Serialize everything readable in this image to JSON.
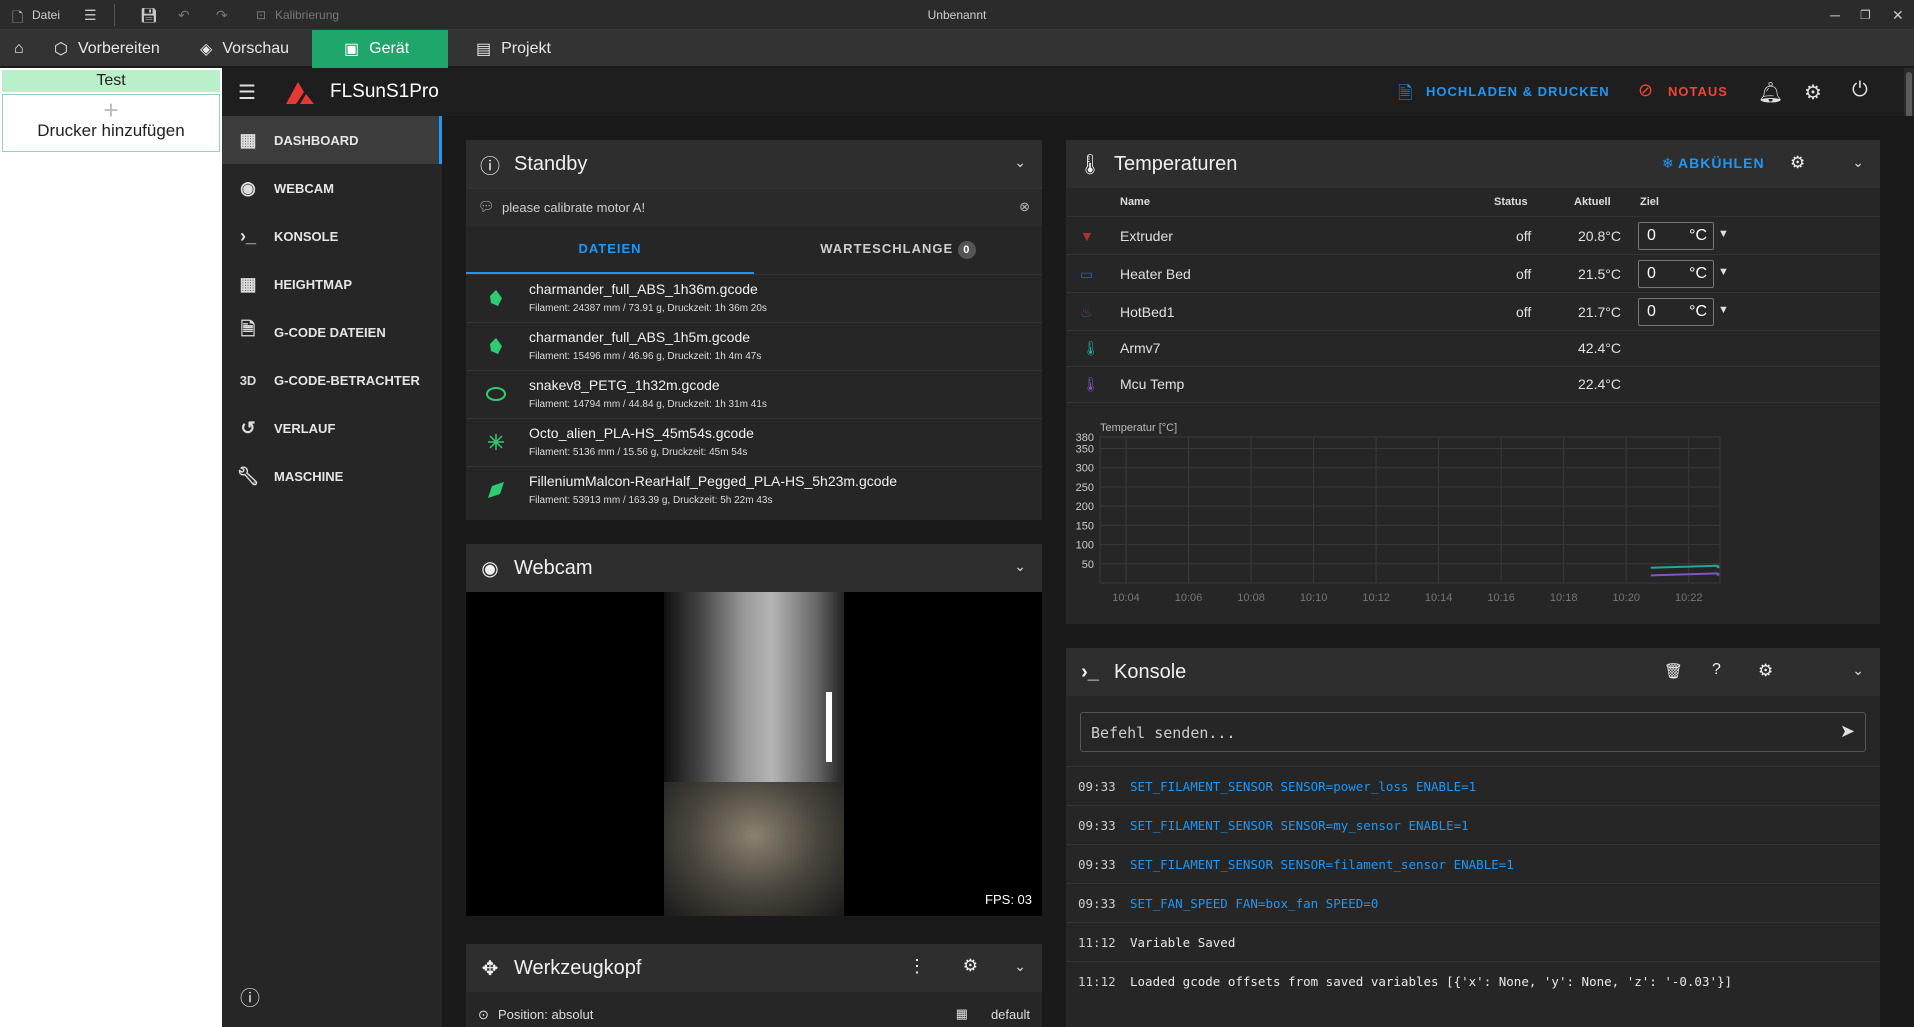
{
  "titlebar": {
    "file_label": "Datei",
    "calib_label": "Kalibrierung",
    "title": "Unbenannt"
  },
  "apptabs": [
    {
      "label": "Vorbereiten"
    },
    {
      "label": "Vorschau"
    },
    {
      "label": "Gerät"
    },
    {
      "label": "Projekt"
    }
  ],
  "printers": {
    "tab_label": "Test",
    "add_label": "Drucker hinzufügen"
  },
  "header": {
    "printer_name": "FLSunS1Pro",
    "upload_label": "HOCHLADEN & DRUCKEN",
    "estop_label": "NOTAUS",
    "colors": {
      "accent": "#2196f3",
      "danger": "#f44336"
    }
  },
  "nav": [
    {
      "label": "DASHBOARD",
      "icon": "dashboard-icon"
    },
    {
      "label": "WEBCAM",
      "icon": "webcam-icon"
    },
    {
      "label": "KONSOLE",
      "icon": "console-icon"
    },
    {
      "label": "HEIGHTMAP",
      "icon": "grid-icon"
    },
    {
      "label": "G-CODE DATEIEN",
      "icon": "file-icon"
    },
    {
      "label": "G-CODE-BETRACHTER",
      "icon": "3d-icon"
    },
    {
      "label": "VERLAUF",
      "icon": "history-icon"
    },
    {
      "label": "MASCHINE",
      "icon": "wrench-icon"
    }
  ],
  "status": {
    "title": "Standby",
    "message": "please calibrate motor A!",
    "tab_files": "DATEIEN",
    "tab_queue": "WARTESCHLANGE",
    "queue_count": "0",
    "files": [
      {
        "name": "charmander_full_ABS_1h36m.gcode",
        "meta": "Filament: 24387 mm / 73.91 g, Druckzeit: 1h 36m 20s"
      },
      {
        "name": "charmander_full_ABS_1h5m.gcode",
        "meta": "Filament: 15496 mm / 46.96 g, Druckzeit: 1h 4m 47s"
      },
      {
        "name": "snakev8_PETG_1h32m.gcode",
        "meta": "Filament: 14794 mm / 44.84 g, Druckzeit: 1h 31m 41s"
      },
      {
        "name": "Octo_alien_PLA-HS_45m54s.gcode",
        "meta": "Filament: 5136 mm / 15.56 g, Druckzeit: 45m 54s"
      },
      {
        "name": "FilleniumMalcon-RearHalf_Pegged_PLA-HS_5h23m.gcode",
        "meta": "Filament: 53913 mm / 163.39 g, Druckzeit: 5h 22m 43s"
      }
    ]
  },
  "webcam": {
    "title": "Webcam",
    "fps": "FPS: 03"
  },
  "toolhead": {
    "title": "Werkzeugkopf",
    "position": "Position: absolut",
    "profile": "default"
  },
  "temps": {
    "title": "Temperaturen",
    "cool_label": "ABKÜHLEN",
    "columns": {
      "name": "Name",
      "status": "Status",
      "actual": "Aktuell",
      "target": "Ziel"
    },
    "unit": "°C",
    "rows": [
      {
        "name": "Extruder",
        "status": "off",
        "actual": "20.8°C",
        "target": "0"
      },
      {
        "name": "Heater Bed",
        "status": "off",
        "actual": "21.5°C",
        "target": "0"
      },
      {
        "name": "HotBed1",
        "status": "off",
        "actual": "21.7°C",
        "target": "0"
      },
      {
        "name": "Armv7",
        "status": "",
        "actual": "42.4°C",
        "target": ""
      },
      {
        "name": "Mcu Temp",
        "status": "",
        "actual": "22.4°C",
        "target": ""
      }
    ]
  },
  "chart_data": {
    "type": "line",
    "title": "",
    "ylabel": "Temperatur [°C]",
    "xlabel": "",
    "ylim": [
      0,
      380
    ],
    "yticks": [
      50,
      100,
      150,
      200,
      250,
      300,
      350,
      380
    ],
    "x": [
      "10:04",
      "10:06",
      "10:08",
      "10:10",
      "10:12",
      "10:14",
      "10:16",
      "10:18",
      "10:20",
      "10:22"
    ],
    "grid": true,
    "series": [
      {
        "values": [
          null,
          null,
          null,
          null,
          null,
          null,
          null,
          null,
          null,
          42.4
        ],
        "color": "#26a69a"
      },
      {
        "values": [
          null,
          null,
          null,
          null,
          null,
          null,
          null,
          null,
          null,
          22.4
        ],
        "color": "#7e57c2"
      }
    ]
  },
  "console": {
    "title": "Konsole",
    "placeholder": "Befehl senden...",
    "lines": [
      {
        "time": "09:33",
        "text": "SET_FILAMENT_SENSOR SENSOR=power_loss ENABLE=1",
        "cmd": true
      },
      {
        "time": "09:33",
        "text": "SET_FILAMENT_SENSOR SENSOR=my_sensor ENABLE=1",
        "cmd": true
      },
      {
        "time": "09:33",
        "text": "SET_FILAMENT_SENSOR SENSOR=filament_sensor ENABLE=1",
        "cmd": true
      },
      {
        "time": "09:33",
        "text": "SET_FAN_SPEED FAN=box_fan SPEED=0",
        "cmd": true
      },
      {
        "time": "11:12",
        "text": "Variable Saved",
        "cmd": false
      },
      {
        "time": "11:12",
        "text": "Loaded gcode offsets from saved variables [{'x': None, 'y': None, 'z': '-0.03'}]",
        "cmd": false
      }
    ]
  }
}
